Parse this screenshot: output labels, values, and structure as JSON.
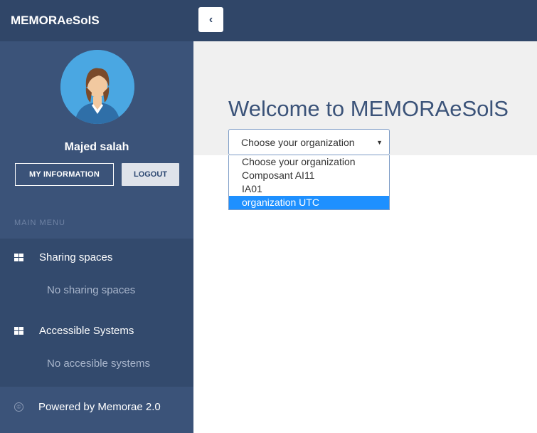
{
  "brand": {
    "title": "MEMORAeSolS"
  },
  "profile": {
    "avatar": "user-avatar",
    "name": "Majed salah",
    "my_information_label": "MY INFORMATION",
    "logout_label": "LOGOUT"
  },
  "menu": {
    "header": "MAIN MENU",
    "sharing": {
      "label": "Sharing spaces",
      "empty": "No sharing spaces",
      "icon": "grid-icon"
    },
    "systems": {
      "label": "Accessible Systems",
      "empty": "No accesible systems",
      "icon": "grid-icon"
    }
  },
  "footer": {
    "label": "Powered by Memorae 2.0",
    "icon": "copyright-icon"
  },
  "topbar": {
    "toggle_icon": "chevron-left-icon",
    "toggle_glyph": "‹"
  },
  "main": {
    "welcome": "Welcome to MEMORAeSolS",
    "select": {
      "value": "Choose your organization",
      "options": [
        "Choose your organization",
        "Composant AI11",
        "IA01",
        "organization UTC"
      ],
      "highlighted": "organization UTC"
    }
  },
  "colors": {
    "sidebar": "#3b5379",
    "topbar": "#304668",
    "highlight": "#1e90ff",
    "title": "#3b5379"
  }
}
